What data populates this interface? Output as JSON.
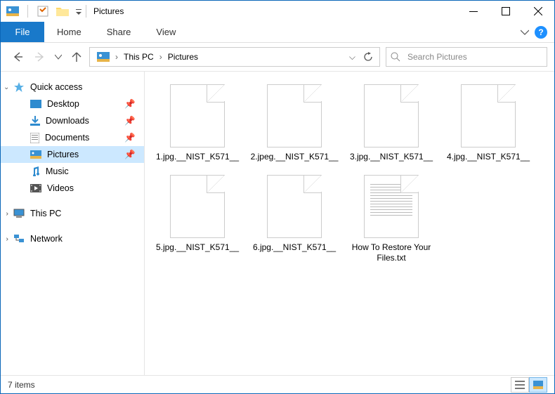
{
  "window": {
    "title": "Pictures"
  },
  "ribbon": {
    "file": "File",
    "tabs": [
      "Home",
      "Share",
      "View"
    ]
  },
  "breadcrumb": {
    "parts": [
      "This PC",
      "Pictures"
    ]
  },
  "search": {
    "placeholder": "Search Pictures"
  },
  "sidebar": {
    "quick_access": "Quick access",
    "qa_items": [
      {
        "label": "Desktop"
      },
      {
        "label": "Downloads"
      },
      {
        "label": "Documents"
      },
      {
        "label": "Pictures"
      },
      {
        "label": "Music"
      },
      {
        "label": "Videos"
      }
    ],
    "this_pc": "This PC",
    "network": "Network"
  },
  "files": [
    {
      "name": "1.jpg.__NIST_K571__",
      "type": "blank"
    },
    {
      "name": "2.jpeg.__NIST_K571__",
      "type": "blank"
    },
    {
      "name": "3.jpg.__NIST_K571__",
      "type": "blank"
    },
    {
      "name": "4.jpg.__NIST_K571__",
      "type": "blank"
    },
    {
      "name": "5.jpg.__NIST_K571__",
      "type": "blank"
    },
    {
      "name": "6.jpg.__NIST_K571__",
      "type": "blank"
    },
    {
      "name": "How To Restore Your Files.txt",
      "type": "text"
    }
  ],
  "status": {
    "count": "7 items"
  }
}
